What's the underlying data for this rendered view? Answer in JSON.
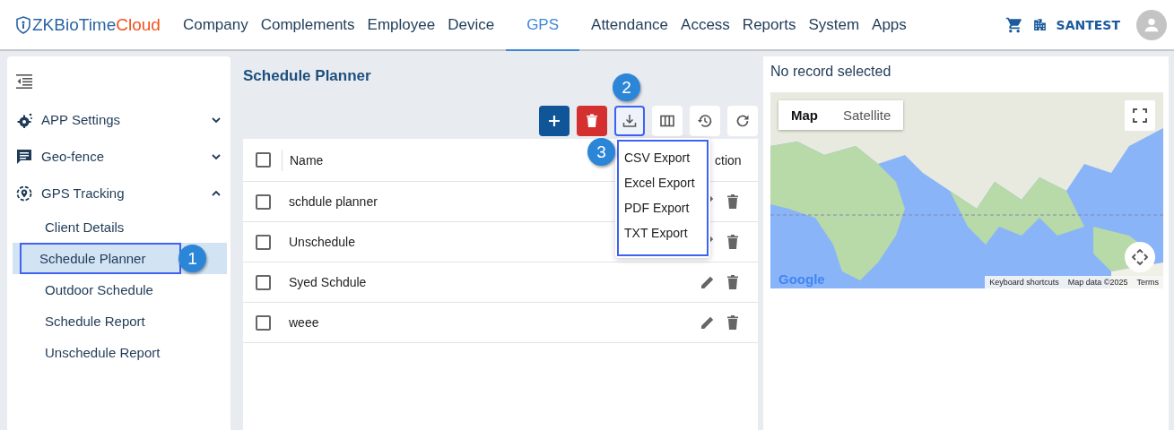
{
  "header": {
    "logo": {
      "main": "ZKBioTime",
      "accent": "Cloud"
    },
    "nav": [
      {
        "label": "Company",
        "selected": false
      },
      {
        "label": "Complements",
        "selected": false
      },
      {
        "label": "Employee",
        "selected": false
      },
      {
        "label": "Device",
        "selected": false
      },
      {
        "label": "GPS",
        "selected": true
      },
      {
        "label": "Attendance",
        "selected": false
      },
      {
        "label": "Access",
        "selected": false
      },
      {
        "label": "Reports",
        "selected": false
      },
      {
        "label": "System",
        "selected": false
      },
      {
        "label": "Apps",
        "selected": false
      }
    ],
    "company": "SANTEST"
  },
  "sidebar": {
    "groups": [
      {
        "kind": "settings",
        "label": "APP Settings",
        "expanded": false
      },
      {
        "kind": "chat",
        "label": "Geo-fence",
        "expanded": false
      },
      {
        "kind": "location",
        "label": "GPS Tracking",
        "expanded": true,
        "children": [
          {
            "label": "Client Details",
            "selected": false,
            "highlighted": false
          },
          {
            "label": "Schedule Planner",
            "selected": true,
            "highlighted": true,
            "callout": "1"
          },
          {
            "label": "Outdoor Schedule",
            "selected": false,
            "highlighted": false
          },
          {
            "label": "Schedule Report",
            "selected": false,
            "highlighted": false
          },
          {
            "label": "Unschedule Report",
            "selected": false,
            "highlighted": false
          }
        ]
      }
    ]
  },
  "page_title": "Schedule Planner",
  "toolbar": [
    {
      "kind": "add",
      "highlighted": false
    },
    {
      "kind": "delete",
      "highlighted": false
    },
    {
      "kind": "export",
      "highlighted": true,
      "callout": "2",
      "expanded": true
    },
    {
      "kind": "columns",
      "highlighted": false
    },
    {
      "kind": "history",
      "highlighted": false
    },
    {
      "kind": "refresh",
      "highlighted": false
    }
  ],
  "export_menu": {
    "highlighted": true,
    "callout": "3",
    "items": [
      "CSV Export",
      "Excel Export",
      "PDF Export",
      "TXT Export"
    ]
  },
  "table": {
    "select_all_checked": false,
    "columns": [
      "Name",
      "ction"
    ],
    "rows": [
      {
        "name": "schdule planner",
        "checked": false
      },
      {
        "name": "Unschedule",
        "checked": false
      },
      {
        "name": "Syed Schdule",
        "checked": false
      },
      {
        "name": "weee",
        "checked": false
      }
    ]
  },
  "detail": {
    "message": "No record selected",
    "map": {
      "tabs": [
        {
          "label": "Map",
          "selected": true
        },
        {
          "label": "Satellite",
          "selected": false
        }
      ],
      "logo": "Google",
      "footer": [
        "Keyboard shortcuts",
        "Map data ©2025",
        "Terms"
      ]
    }
  }
}
